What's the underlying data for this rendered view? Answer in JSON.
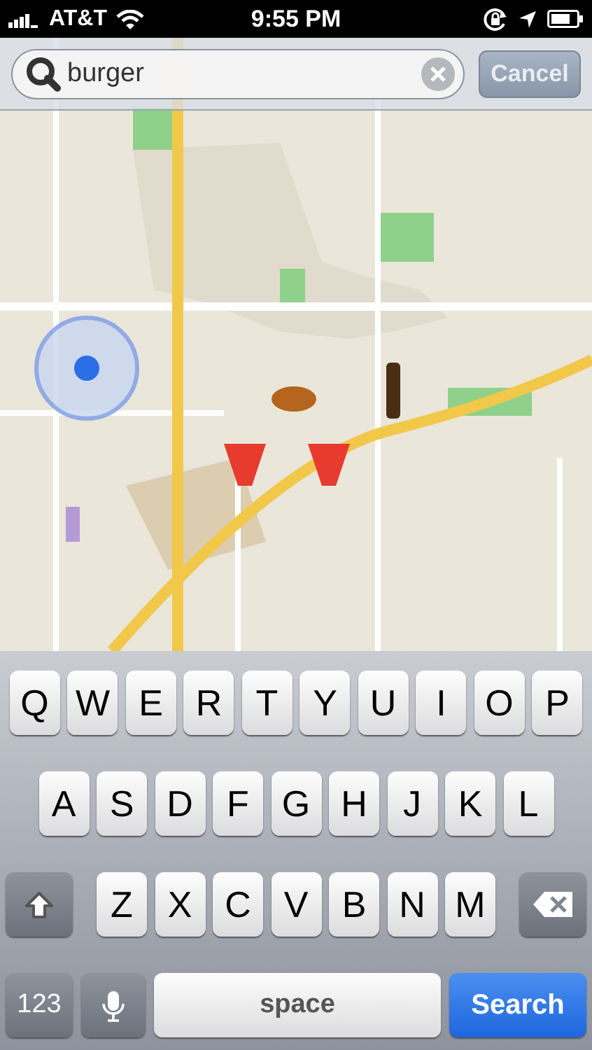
{
  "status_bar": {
    "carrier": "AT&T",
    "time": "9:55 PM"
  },
  "search": {
    "value": "burger",
    "cancel": "Cancel"
  },
  "keyboard": {
    "rows": [
      [
        "Q",
        "W",
        "E",
        "R",
        "T",
        "Y",
        "U",
        "I",
        "O",
        "P"
      ],
      [
        "A",
        "S",
        "D",
        "F",
        "G",
        "H",
        "J",
        "K",
        "L"
      ],
      [
        "Z",
        "X",
        "C",
        "V",
        "B",
        "N",
        "M"
      ]
    ],
    "numbers": "123",
    "space": "space",
    "action": "Search"
  }
}
